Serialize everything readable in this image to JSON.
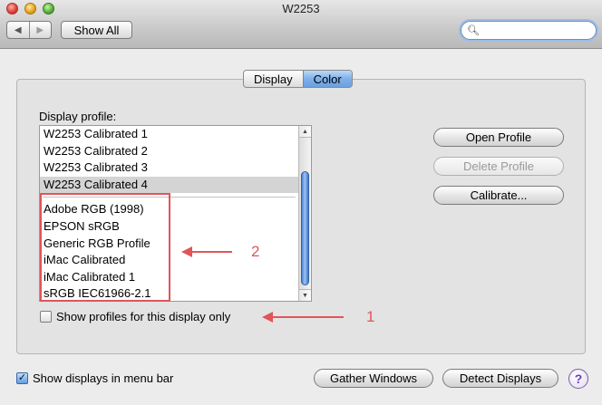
{
  "window": {
    "title": "W2253"
  },
  "toolbar": {
    "back_label": "◀",
    "forward_label": "▶",
    "show_all_label": "Show All",
    "search": {
      "value": "",
      "placeholder": ""
    }
  },
  "tabs": [
    {
      "label": "Display",
      "selected": false
    },
    {
      "label": "Color",
      "selected": true
    }
  ],
  "color_panel": {
    "display_profile_label": "Display profile:",
    "profiles": {
      "display_specific": [
        "W2253 Calibrated 1",
        "W2253 Calibrated 2",
        "W2253 Calibrated 3",
        "W2253 Calibrated 4"
      ],
      "selected": "W2253 Calibrated 4",
      "general": [
        "Adobe RGB (1998)",
        "EPSON  sRGB",
        "Generic RGB Profile",
        "iMac Calibrated",
        "iMac Calibrated 1",
        "sRGB IEC61966-2.1"
      ]
    },
    "show_profiles_checkbox": {
      "label": "Show profiles for this display only",
      "checked": false
    },
    "open_profile_label": "Open Profile",
    "delete_profile_label": "Delete Profile",
    "calibrate_label": "Calibrate..."
  },
  "footer": {
    "show_displays_checkbox": {
      "label": "Show displays in menu bar",
      "checked": true
    },
    "gather_windows_label": "Gather Windows",
    "detect_displays_label": "Detect Displays",
    "help_label": "?"
  },
  "annotations": {
    "label_1": "1",
    "label_2": "2",
    "color": "#e0555a"
  },
  "colors": {
    "selection_blue": "#7fb0ea",
    "row_selected": "#d4d4d4"
  },
  "icons": {
    "search": "search-icon",
    "back": "arrow-left-icon",
    "forward": "arrow-right-icon",
    "help": "question-mark-icon"
  }
}
